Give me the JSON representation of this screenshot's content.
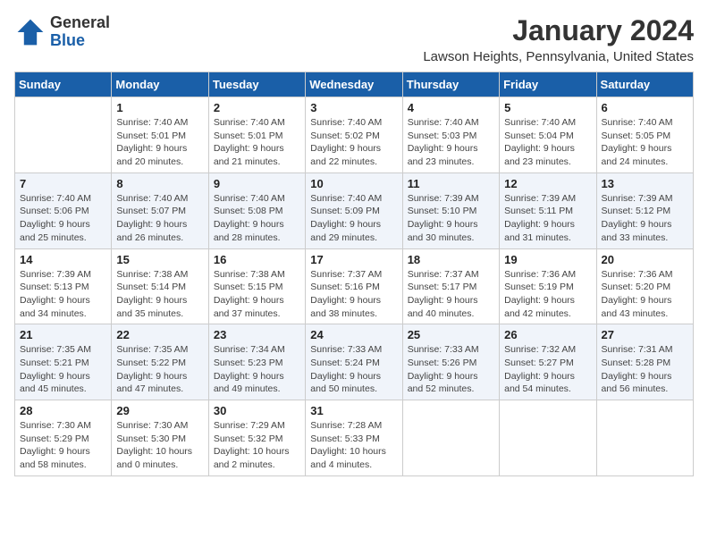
{
  "logo": {
    "general": "General",
    "blue": "Blue"
  },
  "title": "January 2024",
  "subtitle": "Lawson Heights, Pennsylvania, United States",
  "columns": [
    "Sunday",
    "Monday",
    "Tuesday",
    "Wednesday",
    "Thursday",
    "Friday",
    "Saturday"
  ],
  "weeks": [
    [
      {
        "day": "",
        "sunrise": "",
        "sunset": "",
        "daylight": ""
      },
      {
        "day": "1",
        "sunrise": "Sunrise: 7:40 AM",
        "sunset": "Sunset: 5:01 PM",
        "daylight": "Daylight: 9 hours and 20 minutes."
      },
      {
        "day": "2",
        "sunrise": "Sunrise: 7:40 AM",
        "sunset": "Sunset: 5:01 PM",
        "daylight": "Daylight: 9 hours and 21 minutes."
      },
      {
        "day": "3",
        "sunrise": "Sunrise: 7:40 AM",
        "sunset": "Sunset: 5:02 PM",
        "daylight": "Daylight: 9 hours and 22 minutes."
      },
      {
        "day": "4",
        "sunrise": "Sunrise: 7:40 AM",
        "sunset": "Sunset: 5:03 PM",
        "daylight": "Daylight: 9 hours and 23 minutes."
      },
      {
        "day": "5",
        "sunrise": "Sunrise: 7:40 AM",
        "sunset": "Sunset: 5:04 PM",
        "daylight": "Daylight: 9 hours and 23 minutes."
      },
      {
        "day": "6",
        "sunrise": "Sunrise: 7:40 AM",
        "sunset": "Sunset: 5:05 PM",
        "daylight": "Daylight: 9 hours and 24 minutes."
      }
    ],
    [
      {
        "day": "7",
        "sunrise": "Sunrise: 7:40 AM",
        "sunset": "Sunset: 5:06 PM",
        "daylight": "Daylight: 9 hours and 25 minutes."
      },
      {
        "day": "8",
        "sunrise": "Sunrise: 7:40 AM",
        "sunset": "Sunset: 5:07 PM",
        "daylight": "Daylight: 9 hours and 26 minutes."
      },
      {
        "day": "9",
        "sunrise": "Sunrise: 7:40 AM",
        "sunset": "Sunset: 5:08 PM",
        "daylight": "Daylight: 9 hours and 28 minutes."
      },
      {
        "day": "10",
        "sunrise": "Sunrise: 7:40 AM",
        "sunset": "Sunset: 5:09 PM",
        "daylight": "Daylight: 9 hours and 29 minutes."
      },
      {
        "day": "11",
        "sunrise": "Sunrise: 7:39 AM",
        "sunset": "Sunset: 5:10 PM",
        "daylight": "Daylight: 9 hours and 30 minutes."
      },
      {
        "day": "12",
        "sunrise": "Sunrise: 7:39 AM",
        "sunset": "Sunset: 5:11 PM",
        "daylight": "Daylight: 9 hours and 31 minutes."
      },
      {
        "day": "13",
        "sunrise": "Sunrise: 7:39 AM",
        "sunset": "Sunset: 5:12 PM",
        "daylight": "Daylight: 9 hours and 33 minutes."
      }
    ],
    [
      {
        "day": "14",
        "sunrise": "Sunrise: 7:39 AM",
        "sunset": "Sunset: 5:13 PM",
        "daylight": "Daylight: 9 hours and 34 minutes."
      },
      {
        "day": "15",
        "sunrise": "Sunrise: 7:38 AM",
        "sunset": "Sunset: 5:14 PM",
        "daylight": "Daylight: 9 hours and 35 minutes."
      },
      {
        "day": "16",
        "sunrise": "Sunrise: 7:38 AM",
        "sunset": "Sunset: 5:15 PM",
        "daylight": "Daylight: 9 hours and 37 minutes."
      },
      {
        "day": "17",
        "sunrise": "Sunrise: 7:37 AM",
        "sunset": "Sunset: 5:16 PM",
        "daylight": "Daylight: 9 hours and 38 minutes."
      },
      {
        "day": "18",
        "sunrise": "Sunrise: 7:37 AM",
        "sunset": "Sunset: 5:17 PM",
        "daylight": "Daylight: 9 hours and 40 minutes."
      },
      {
        "day": "19",
        "sunrise": "Sunrise: 7:36 AM",
        "sunset": "Sunset: 5:19 PM",
        "daylight": "Daylight: 9 hours and 42 minutes."
      },
      {
        "day": "20",
        "sunrise": "Sunrise: 7:36 AM",
        "sunset": "Sunset: 5:20 PM",
        "daylight": "Daylight: 9 hours and 43 minutes."
      }
    ],
    [
      {
        "day": "21",
        "sunrise": "Sunrise: 7:35 AM",
        "sunset": "Sunset: 5:21 PM",
        "daylight": "Daylight: 9 hours and 45 minutes."
      },
      {
        "day": "22",
        "sunrise": "Sunrise: 7:35 AM",
        "sunset": "Sunset: 5:22 PM",
        "daylight": "Daylight: 9 hours and 47 minutes."
      },
      {
        "day": "23",
        "sunrise": "Sunrise: 7:34 AM",
        "sunset": "Sunset: 5:23 PM",
        "daylight": "Daylight: 9 hours and 49 minutes."
      },
      {
        "day": "24",
        "sunrise": "Sunrise: 7:33 AM",
        "sunset": "Sunset: 5:24 PM",
        "daylight": "Daylight: 9 hours and 50 minutes."
      },
      {
        "day": "25",
        "sunrise": "Sunrise: 7:33 AM",
        "sunset": "Sunset: 5:26 PM",
        "daylight": "Daylight: 9 hours and 52 minutes."
      },
      {
        "day": "26",
        "sunrise": "Sunrise: 7:32 AM",
        "sunset": "Sunset: 5:27 PM",
        "daylight": "Daylight: 9 hours and 54 minutes."
      },
      {
        "day": "27",
        "sunrise": "Sunrise: 7:31 AM",
        "sunset": "Sunset: 5:28 PM",
        "daylight": "Daylight: 9 hours and 56 minutes."
      }
    ],
    [
      {
        "day": "28",
        "sunrise": "Sunrise: 7:30 AM",
        "sunset": "Sunset: 5:29 PM",
        "daylight": "Daylight: 9 hours and 58 minutes."
      },
      {
        "day": "29",
        "sunrise": "Sunrise: 7:30 AM",
        "sunset": "Sunset: 5:30 PM",
        "daylight": "Daylight: 10 hours and 0 minutes."
      },
      {
        "day": "30",
        "sunrise": "Sunrise: 7:29 AM",
        "sunset": "Sunset: 5:32 PM",
        "daylight": "Daylight: 10 hours and 2 minutes."
      },
      {
        "day": "31",
        "sunrise": "Sunrise: 7:28 AM",
        "sunset": "Sunset: 5:33 PM",
        "daylight": "Daylight: 10 hours and 4 minutes."
      },
      {
        "day": "",
        "sunrise": "",
        "sunset": "",
        "daylight": ""
      },
      {
        "day": "",
        "sunrise": "",
        "sunset": "",
        "daylight": ""
      },
      {
        "day": "",
        "sunrise": "",
        "sunset": "",
        "daylight": ""
      }
    ]
  ]
}
